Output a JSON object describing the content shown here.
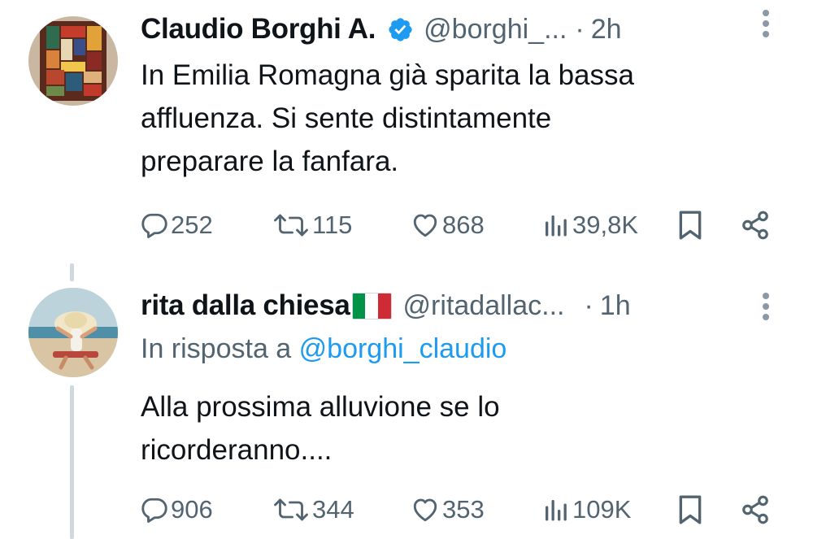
{
  "tweets": [
    {
      "display_name": "Claudio Borghi A.",
      "verified": true,
      "handle": "@borghi_...",
      "separator": "·",
      "time": "2h",
      "text_lines": [
        "In Emilia Romagna già sparita la bassa",
        "affluenza. Si sente distintamente",
        "preparare la fanfara."
      ],
      "stats": {
        "replies": "252",
        "retweets": "115",
        "likes": "868",
        "views": "39,8K"
      }
    },
    {
      "display_name": "rita dalla chiesa",
      "flag": "italy-flag",
      "handle": "@ritadallac...",
      "separator": "·",
      "time": "1h",
      "reply_prefix": "In risposta a ",
      "reply_to": "@borghi_claudio",
      "text_lines": [
        "Alla prossima alluvione se lo",
        "ricorderanno...."
      ],
      "stats": {
        "replies": "906",
        "retweets": "344",
        "likes": "353",
        "views": "109K"
      }
    }
  ],
  "icons": {
    "reply": "speech-bubble-icon",
    "retweet": "retweet-icon",
    "like": "heart-icon",
    "views": "bar-chart-icon",
    "bookmark": "bookmark-icon",
    "share": "share-icon",
    "more": "more-vertical-icon",
    "verified": "verified-badge-icon"
  },
  "colors": {
    "text": "#0f1419",
    "secondary": "#536471",
    "accent": "#1d9bf0",
    "thread_line": "#cfd9de"
  }
}
